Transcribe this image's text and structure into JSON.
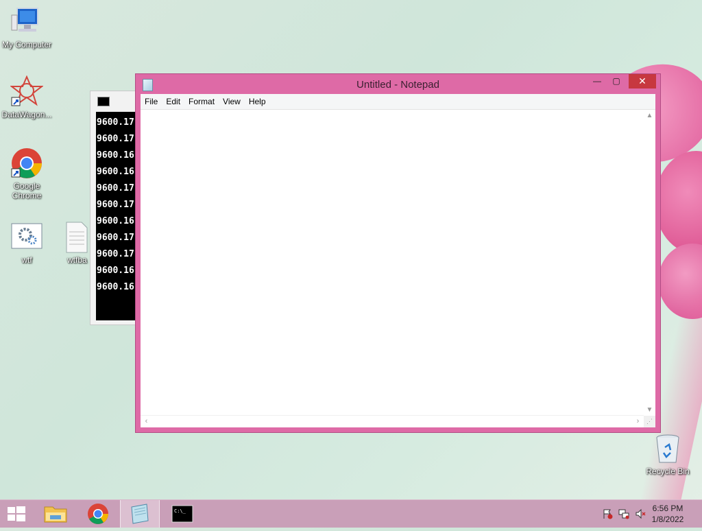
{
  "desktop": {
    "icons": [
      {
        "label": "My Computer",
        "icon": "computer-icon"
      },
      {
        "label": "DataWagon...",
        "icon": "datawagon-icon"
      },
      {
        "label": "Google Chrome",
        "icon": "chrome-icon"
      },
      {
        "label": "wtf",
        "icon": "settings-file-icon"
      },
      {
        "label": "wtfba",
        "icon": "text-file-icon"
      },
      {
        "label": "Recycle Bin",
        "icon": "recycle-bin-icon"
      }
    ]
  },
  "console": {
    "lines": [
      "9600.17",
      "9600.17",
      "9600.16",
      "9600.16",
      "9600.17",
      "9600.17",
      "9600.16",
      "9600.17",
      "9600.17",
      "9600.16",
      "9600.16"
    ]
  },
  "notepad": {
    "title": "Untitled - Notepad",
    "menu": [
      "File",
      "Edit",
      "Format",
      "View",
      "Help"
    ],
    "content": "",
    "controls": {
      "minimize": "—",
      "maximize": "▢",
      "close": "✕"
    }
  },
  "taskbar": {
    "clock_time": "6:56 PM",
    "clock_date": "1/8/2022",
    "pinned": [
      "start-button",
      "file-explorer",
      "chrome",
      "notepad",
      "command-prompt"
    ]
  },
  "colors": {
    "accent": "#de6aa6",
    "taskbar": "#c99fb8",
    "close": "#c7383f"
  }
}
